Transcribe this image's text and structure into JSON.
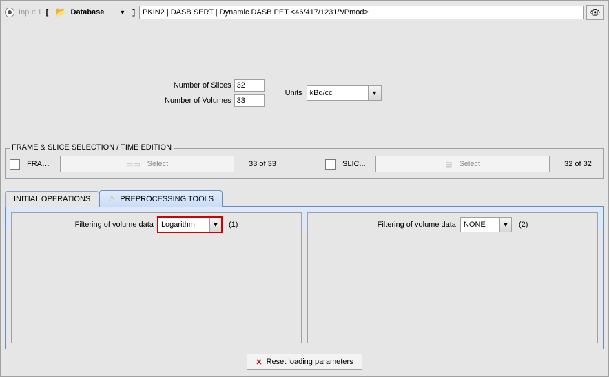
{
  "input_label": "Input 1",
  "source": {
    "label": "Database"
  },
  "path": "PKIN2 | DASB SERT | Dynamic DASB PET <46/417/1231/*/Pmod>",
  "slices": {
    "label": "Number of Slices",
    "value": "32"
  },
  "volumes": {
    "label": "Number of Volumes",
    "value": "33"
  },
  "units": {
    "label": "Units",
    "value": "kBq/cc"
  },
  "frame_slice": {
    "legend": "FRAME & SLICE SELECTION / TIME EDITION",
    "frame": {
      "checkbox_label": "FRAM...",
      "button": "Select",
      "count": "33 of 33"
    },
    "slice": {
      "checkbox_label": "SLIC...",
      "button": "Select",
      "count": "32 of 32"
    }
  },
  "tabs": {
    "initial": "INITIAL OPERATIONS",
    "preprocess": "PREPROCESSING TOOLS"
  },
  "filter_label": "Filtering of volume data",
  "filter1": {
    "value": "Logarithm",
    "suffix": "(1)"
  },
  "filter2": {
    "value": "NONE",
    "suffix": "(2)"
  },
  "reset": "Reset loading parameters"
}
